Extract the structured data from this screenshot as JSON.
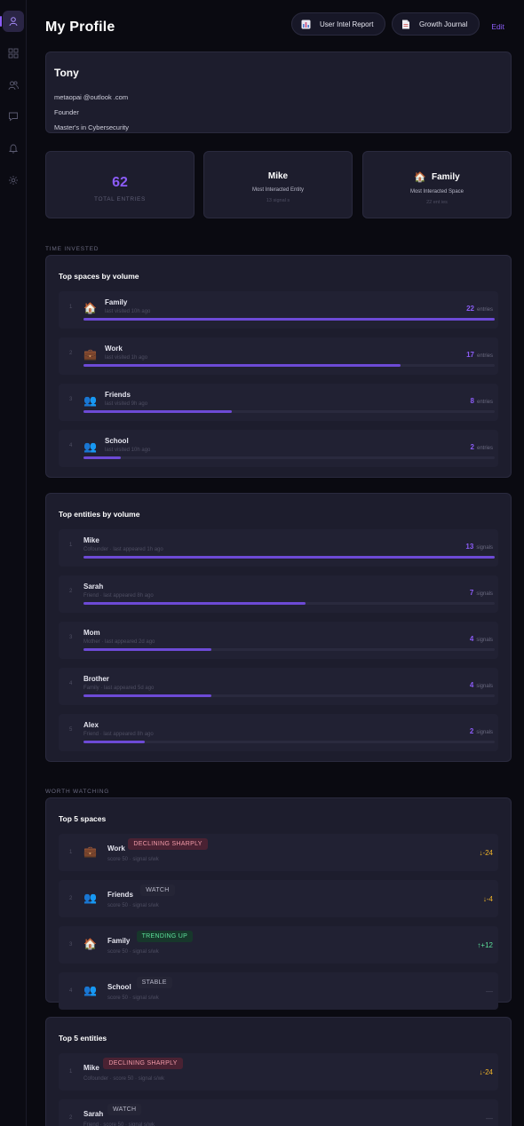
{
  "header": {
    "title": "My Profile",
    "report_label": "User Intel Report",
    "journal_label": "Growth Journal",
    "edit_label": "Edit"
  },
  "sidebar": {
    "items": [
      "profile-icon",
      "grid-icon",
      "users-icon",
      "chat-icon",
      "bell-icon",
      "gear-icon"
    ]
  },
  "profile": {
    "name": "Tony",
    "email": "metaopai @outlook .com",
    "role": "Founder",
    "education": "Master's  in  Cybersecurity"
  },
  "stats": {
    "entries": {
      "value": "62",
      "label": "TOTAL ENTRIES"
    },
    "entity": {
      "name": "Mike",
      "label": "Most  Interacted  Entity",
      "sub": "13 signal s"
    },
    "space": {
      "emoji": "🏠",
      "name": "Family",
      "label": "Most  Interacted  Space",
      "sub": "22  ent ies"
    }
  },
  "time_invested": {
    "section_label": "TIME INVESTED",
    "spaces_title": "Top  spaces  by volume",
    "spaces": [
      {
        "rank": "1",
        "emoji": "🏠",
        "name": "Family",
        "sub": "last  visited  10h  ago",
        "count": "22",
        "unit": "entries",
        "fraction": 1.0
      },
      {
        "rank": "2",
        "emoji": "💼",
        "name": "Work",
        "sub": "last  visited  1h  ago",
        "count": "17",
        "unit": "entries",
        "fraction": 0.77
      },
      {
        "rank": "3",
        "emoji": "👥",
        "name": "Friends",
        "sub": "last  visited  9h  ago",
        "count": "8",
        "unit": "entries",
        "fraction": 0.36
      },
      {
        "rank": "4",
        "emoji": "👥",
        "name": "School",
        "sub": "last  visited  10h  ago",
        "count": "2",
        "unit": "entries",
        "fraction": 0.09
      }
    ],
    "entities_title": "Top  entities  by volume",
    "entities": [
      {
        "rank": "1",
        "name": "Mike",
        "sub": "Cofounder  ·  last  appeared  1h  ago",
        "count": "13",
        "unit": "signals",
        "fraction": 1.0
      },
      {
        "rank": "2",
        "name": "Sarah",
        "sub": "Friend  ·  last  appeared  8h  ago",
        "count": "7",
        "unit": "signals",
        "fraction": 0.54
      },
      {
        "rank": "3",
        "name": "Mom",
        "sub": "Mother  ·  last  appeared  2d  ago",
        "count": "4",
        "unit": "signals",
        "fraction": 0.31
      },
      {
        "rank": "4",
        "name": "Brother",
        "sub": "Family  ·  last  appeared  5d  ago",
        "count": "4",
        "unit": "signals",
        "fraction": 0.31
      },
      {
        "rank": "5",
        "name": "Alex",
        "sub": "Friend  ·  last  appeared  8h  ago",
        "count": "2",
        "unit": "signals",
        "fraction": 0.15
      }
    ]
  },
  "worth_watching": {
    "section_label": "WORTH WATCHING",
    "spaces_title": "Top 5 spaces",
    "spaces": [
      {
        "rank": "1",
        "emoji": "💼",
        "name": "Work",
        "badge": "DECLINING SHARPLY",
        "badge_type": "decline",
        "sub": "score  50  ·  signal s/wk",
        "delta": "↓-24",
        "delta_type": "down"
      },
      {
        "rank": "2",
        "emoji": "👥",
        "name": "Friends",
        "badge": "WATCH",
        "badge_type": "watch",
        "sub": "score  50  ·  signal s/wk",
        "delta": "↓-4",
        "delta_type": "down"
      },
      {
        "rank": "3",
        "emoji": "🏠",
        "name": "Family",
        "badge": "TRENDING UP",
        "badge_type": "trend",
        "sub": "score  50  ·  signal s/wk",
        "delta": "↑+12",
        "delta_type": "up"
      },
      {
        "rank": "4",
        "emoji": "👥",
        "name": "School",
        "badge": "STABLE",
        "badge_type": "stable",
        "sub": "score  50  ·  signal s/wk",
        "delta": "—",
        "delta_type": "flat"
      }
    ],
    "entities_title": "Top 5 entities",
    "entities": [
      {
        "rank": "1",
        "name": "Mike",
        "badge": "DECLINING SHARPLY",
        "badge_type": "decline",
        "sub": "Cofounder  ·  score  50  ·  signal s/wk",
        "delta": "↓-24",
        "delta_type": "down"
      },
      {
        "rank": "2",
        "name": "Sarah",
        "badge": "WATCH",
        "badge_type": "watch",
        "sub": "Friend  ·  score  50  ·  signal s/wk",
        "delta": "—",
        "delta_type": "flat"
      }
    ]
  }
}
